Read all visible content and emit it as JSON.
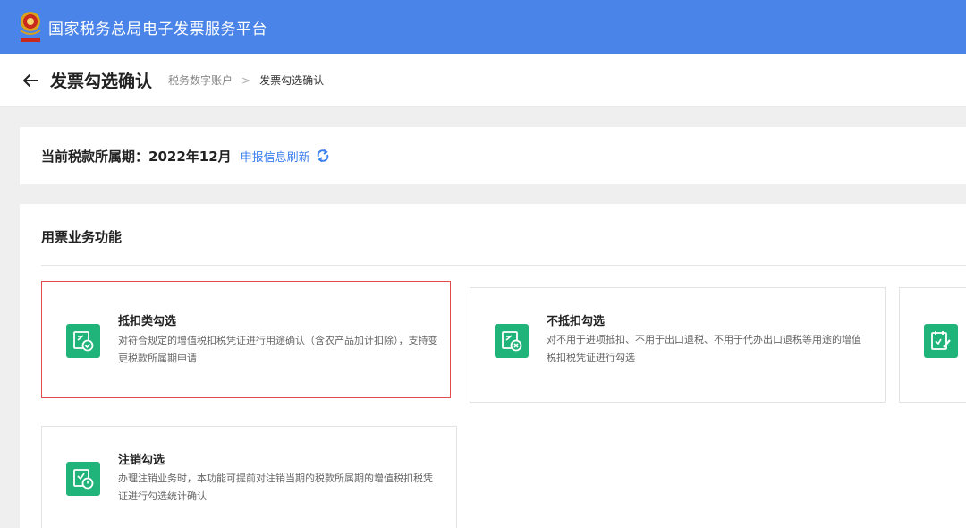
{
  "topbar": {
    "title": "国家税务总局电子发票服务平台",
    "emblem_icon": "tax-emblem",
    "bg_color": "#4b84e8"
  },
  "header": {
    "back_icon": "arrow-left-icon",
    "page_title": "发票勾选确认",
    "breadcrumb": [
      "税务数字账户",
      "发票勾选确认"
    ],
    "separator": ">"
  },
  "period": {
    "label": "当前税款所属期：",
    "value": "2022年12月",
    "refresh_link": "申报信息刷新",
    "refresh_icon": "refresh-icon",
    "link_color": "#3b7ff0"
  },
  "functions": {
    "title": "用票业务功能",
    "accent_color": "#20b47a",
    "cards": [
      {
        "title": "抵扣类勾选",
        "desc": "对符合规定的增值税扣税凭证进行用途确认（含农产品加计扣除），支持变更税款所属期申请",
        "icon": "deduct-check-icon",
        "selected": true
      },
      {
        "title": "不抵扣勾选",
        "desc": "对不用于进项抵扣、不用于出口退税、不用于代办出口退税等用途的增值税扣税凭证进行勾选",
        "icon": "no-deduct-icon",
        "selected": false
      },
      {
        "title": "",
        "desc": "",
        "icon": "edit-check-icon",
        "selected": false
      },
      {
        "title": "注销勾选",
        "desc": "办理注销业务时，本功能可提前对注销当期的税款所属期的增值税扣税凭证进行勾选统计确认",
        "icon": "cancel-check-icon",
        "selected": false
      }
    ]
  }
}
